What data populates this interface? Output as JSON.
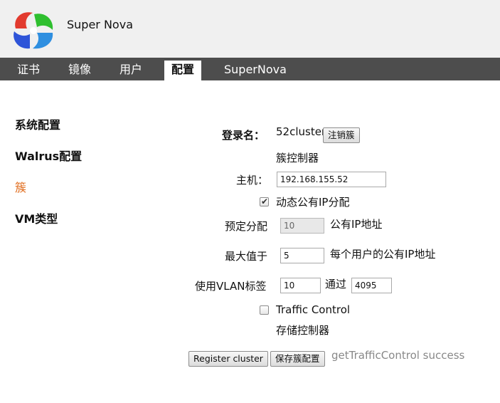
{
  "header": {
    "app_title": "Super Nova"
  },
  "nav": {
    "tabs": [
      {
        "label": "证书"
      },
      {
        "label": "镜像"
      },
      {
        "label": "用户"
      },
      {
        "label": "配置",
        "active": true
      },
      {
        "label": "SuperNova"
      }
    ]
  },
  "sidebar": {
    "items": [
      {
        "label": "系统配置"
      },
      {
        "label": "Walrus配置"
      },
      {
        "label": "簇",
        "active": true
      },
      {
        "label": "VM类型"
      }
    ]
  },
  "form": {
    "login_label": "登录名：",
    "login_value": "52cluster",
    "deregister_button": "注销簇",
    "cluster_controller_heading": "簇控制器",
    "host_label": "主机：",
    "host_value": "192.168.155.52",
    "dynamic_ip_label": "动态公有IP分配",
    "dynamic_ip_checked": true,
    "reserved_label": "预定分配",
    "reserved_value": "10",
    "reserved_unit": "公有IP地址",
    "max_label": "最大值于",
    "max_value": "5",
    "max_unit": "每个用户的公有IP地址",
    "vlan_label": "使用VLAN标签",
    "vlan_min": "10",
    "vlan_sep": "通过",
    "vlan_max": "4095",
    "traffic_control_label": "Traffic Control",
    "traffic_control_checked": false,
    "storage_controller_heading": "存储控制器",
    "register_button": "Register cluster",
    "save_button": "保存簇配置",
    "status_text": "getTrafficControl success"
  },
  "colors": {
    "nav_bg": "#4d4d4d",
    "header_bg": "#f0f0f0",
    "active_sidebar": "#e06b1b",
    "status": "#888888"
  }
}
